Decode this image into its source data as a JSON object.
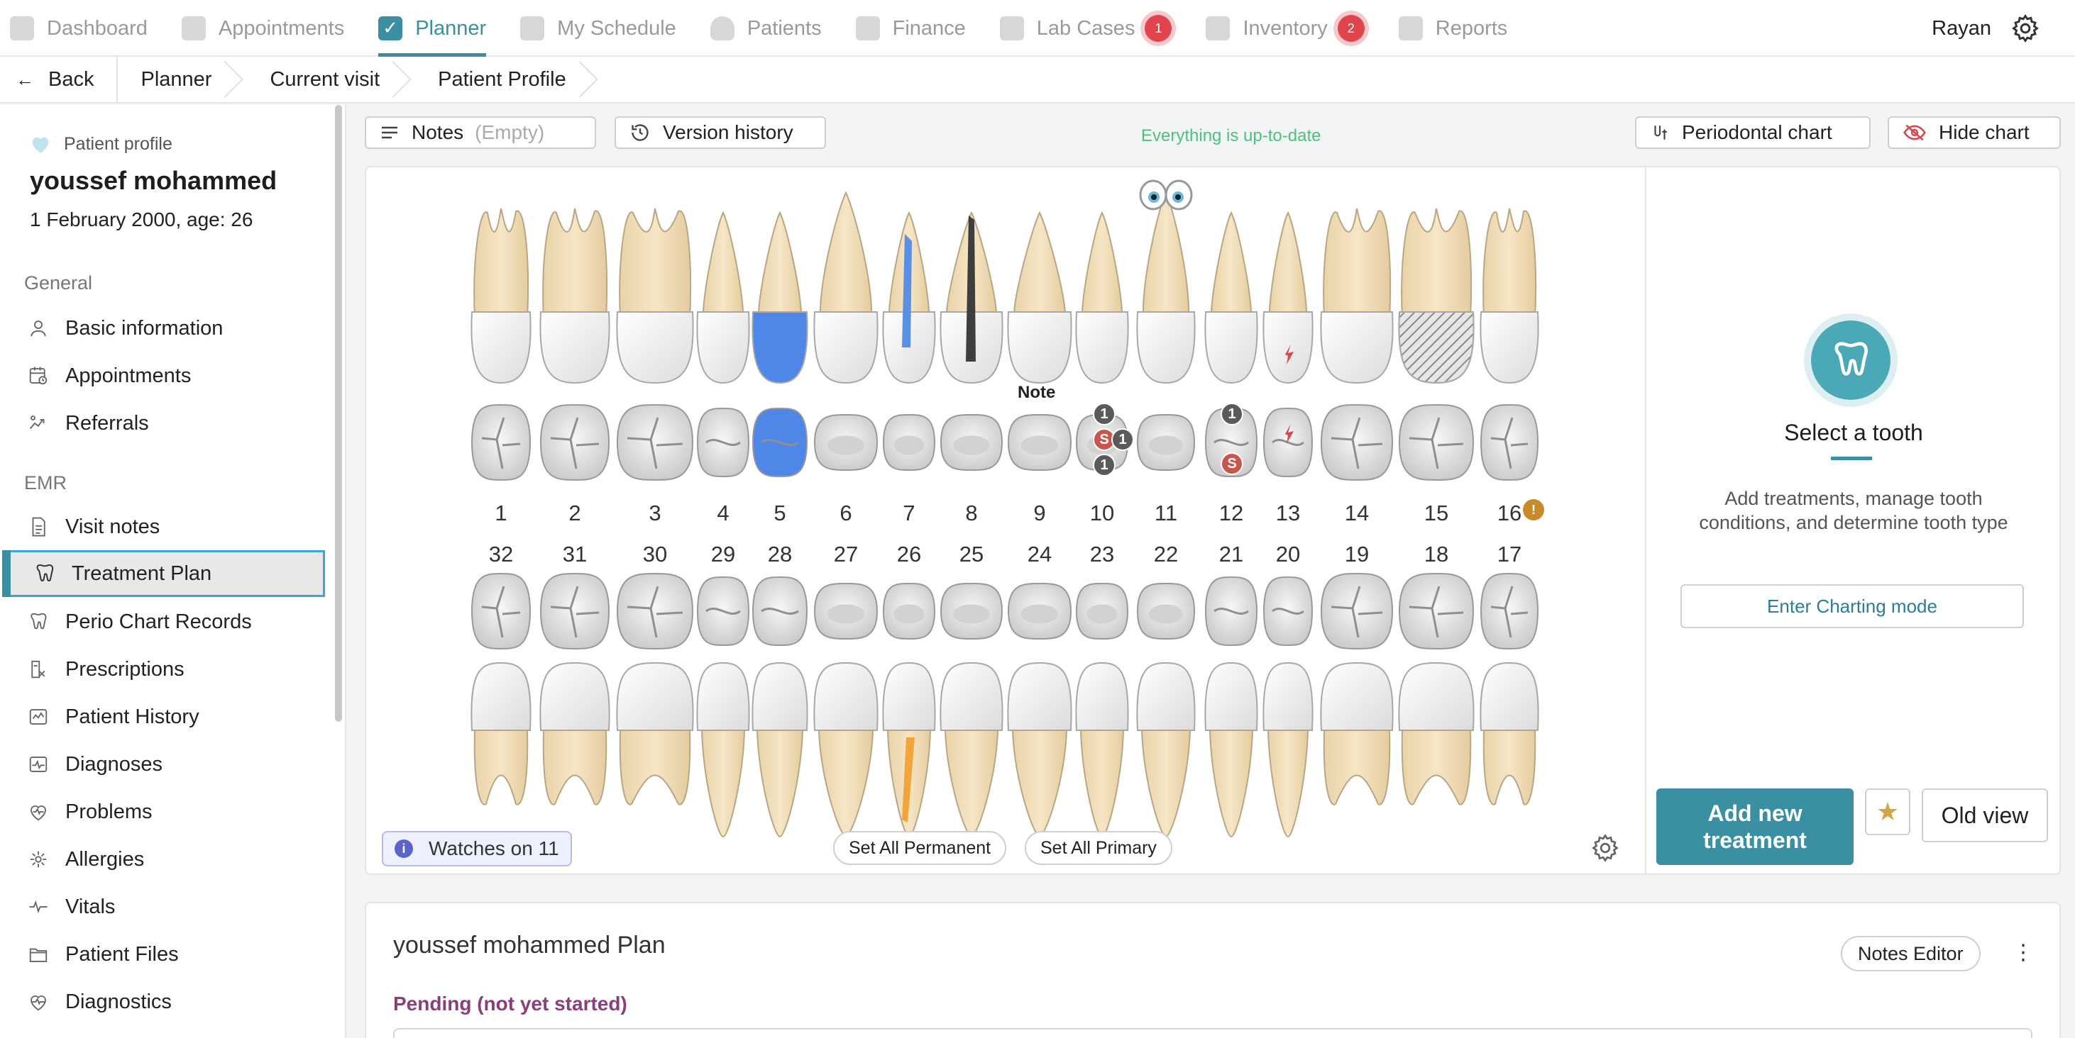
{
  "nav": {
    "items": [
      {
        "label": "Dashboard",
        "icon": "dashboard-icon"
      },
      {
        "label": "Appointments",
        "icon": "calendar-icon"
      },
      {
        "label": "Planner",
        "icon": "checkbox-icon",
        "active": true
      },
      {
        "label": "My Schedule",
        "icon": "schedule-icon"
      },
      {
        "label": "Patients",
        "icon": "heart-icon"
      },
      {
        "label": "Finance",
        "icon": "dollar-icon"
      },
      {
        "label": "Lab Cases",
        "icon": "list-icon",
        "badge": "1"
      },
      {
        "label": "Inventory",
        "icon": "box-icon",
        "badge": "2"
      },
      {
        "label": "Reports",
        "icon": "bar-chart-icon"
      }
    ],
    "user": "Rayan"
  },
  "breadcrumb": {
    "back": "Back",
    "items": [
      "Planner",
      "Current visit",
      "Patient Profile"
    ]
  },
  "sidebar": {
    "profile_label": "Patient profile",
    "patient_name": "youssef mohammed",
    "patient_dob": "1 February 2000, age: 26",
    "general_heading": "General",
    "general_items": [
      "Basic information",
      "Appointments",
      "Referrals"
    ],
    "emr_heading": "EMR",
    "emr_items": [
      "Visit notes",
      "Treatment Plan",
      "Perio Chart Records",
      "Prescriptions",
      "Patient History",
      "Diagnoses",
      "Problems",
      "Allergies",
      "Vitals",
      "Patient Files",
      "Diagnostics"
    ],
    "active_item": "Treatment Plan"
  },
  "toolbar": {
    "notes_label": "Notes",
    "notes_value": "(Empty)",
    "version_history": "Version history",
    "status": "Everything is up-to-date",
    "periodontal": "Periodontal chart",
    "hide_chart": "Hide chart"
  },
  "chart": {
    "upper_numbers": [
      "1",
      "2",
      "3",
      "4",
      "5",
      "6",
      "7",
      "8",
      "9",
      "10",
      "11",
      "12",
      "13",
      "14",
      "15",
      "16"
    ],
    "lower_numbers": [
      "32",
      "31",
      "30",
      "29",
      "28",
      "27",
      "26",
      "25",
      "24",
      "23",
      "22",
      "21",
      "20",
      "19",
      "18",
      "17"
    ],
    "note_label": "Note",
    "indicators": {
      "t10_top": "1",
      "t10_s": "S",
      "t10_right": "1",
      "t10_bottom": "1",
      "t12_top": "1",
      "t12_s": "S",
      "t16_info": "!"
    },
    "watches": "Watches on 11",
    "set_permanent": "Set All Permanent",
    "set_primary": "Set All Primary",
    "colors": {
      "crown": "#4f87e8",
      "root_canal_upper": "#5b8fe6",
      "root_canal_lower": "#f2a53b",
      "post": "#3e3e3e",
      "accent": "#3a8fa3"
    }
  },
  "side_panel": {
    "title": "Select a tooth",
    "description": "Add treatments, manage tooth conditions, and determine tooth type",
    "charting_mode": "Enter Charting mode",
    "add_treatment": "Add new treatment",
    "old_view": "Old view"
  },
  "plan": {
    "title": "youssef mohammed Plan",
    "notes_editor": "Notes Editor",
    "pending": "Pending (not yet started)"
  }
}
